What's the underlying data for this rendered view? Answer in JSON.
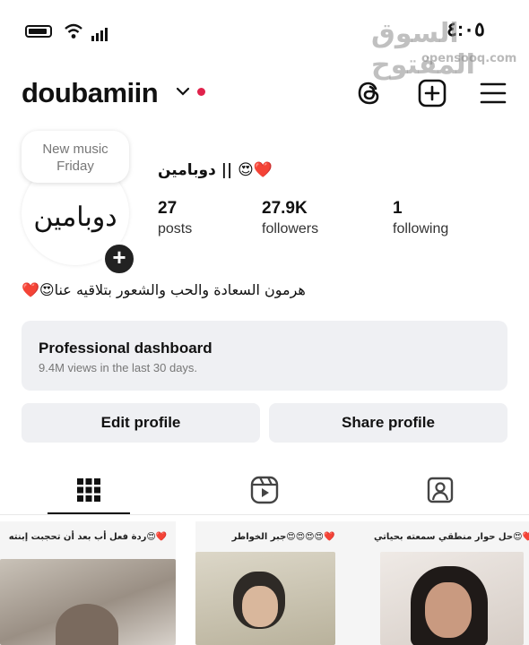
{
  "status": {
    "time": "٤:٠٥"
  },
  "watermark": {
    "text": "السوق المفتوح",
    "sub": "opensooq.com"
  },
  "header": {
    "username": "doubamiin"
  },
  "profile": {
    "note": "New music\nFriday",
    "avatar_text": "دوبامين",
    "display_name": "دوبامين || 😍❤️",
    "stats": [
      {
        "value": "27",
        "label": "posts"
      },
      {
        "value": "27.9K",
        "label": "followers"
      },
      {
        "value": "1",
        "label": "following"
      }
    ],
    "bio": "هرمون السعادة والحب والشعور بتلاقيه عنا😍❤️"
  },
  "dashboard": {
    "title": "Professional dashboard",
    "subtitle": "9.4M views in the last 30 days."
  },
  "buttons": {
    "edit": "Edit profile",
    "share": "Share profile"
  },
  "posts": [
    {
      "caption": "ردة فعل أب بعد أن تحجبت إبنته😍❤️"
    },
    {
      "caption": "جبر الخواطر😍😍😍😍❤️"
    },
    {
      "caption": "حل حوار منطقي سمعته بحياتي😍❤️"
    }
  ],
  "colors": {
    "accent_red": "#e0224b",
    "surface": "#eff0f3"
  }
}
